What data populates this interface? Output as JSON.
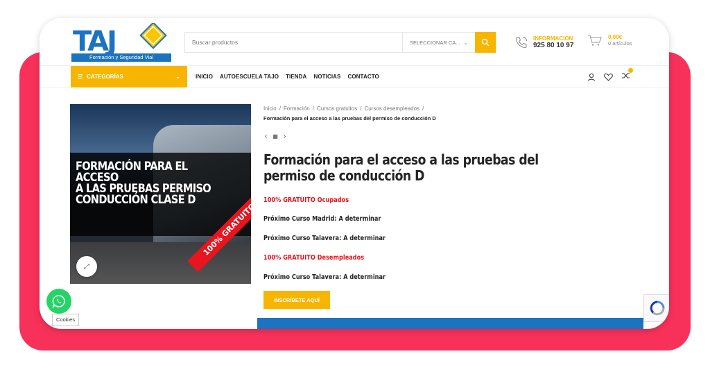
{
  "logo": {
    "text": "TAJ",
    "tagline": "Formación y Seguridad Vial"
  },
  "search": {
    "placeholder": "Buscar productos",
    "category": "SELECCIONAR CA..."
  },
  "info": {
    "title": "INFORMACIÓN",
    "phone": "925 80 10 97"
  },
  "cart": {
    "price": "0,00€",
    "count": "0 artículos"
  },
  "nav": {
    "categories": "CATEGORÍAS",
    "items": [
      "INICIO",
      "AUTOESCUELA TAJO",
      "TIENDA",
      "NOTICIAS",
      "CONTACTO"
    ]
  },
  "image": {
    "lines": [
      "FORMACIÓN PARA EL ACCESO",
      "A LAS PRUEBAS PERMISO",
      "CONDUCCIÓN CLASE D"
    ],
    "ribbon": "100% GRATUITO"
  },
  "breadcrumb": {
    "items": [
      "Inicio",
      "Formación",
      "Cursos gratuitos",
      "Cursos desempleados"
    ],
    "current": "Formación para el acceso a las pruebas del permiso de conducción D",
    "separator": "/"
  },
  "product": {
    "title": "Formación para el acceso a las pruebas del permiso de conducción D",
    "lines": [
      "100% GRATUITO Ocupados",
      "Próximo Curso Madrid: A determinar",
      "Próximo Curso Talavera: A determinar",
      "100% GRATUITO Desempleados",
      "Próximo Curso Talavera: A determinar"
    ],
    "cta": "INSCRÍBETE AQUÍ"
  },
  "cookies": "Cookies",
  "colors": {
    "accent": "#f7b500",
    "brand_blue": "#1c73c0",
    "red": "#e8141e",
    "frame": "#f8315a"
  }
}
